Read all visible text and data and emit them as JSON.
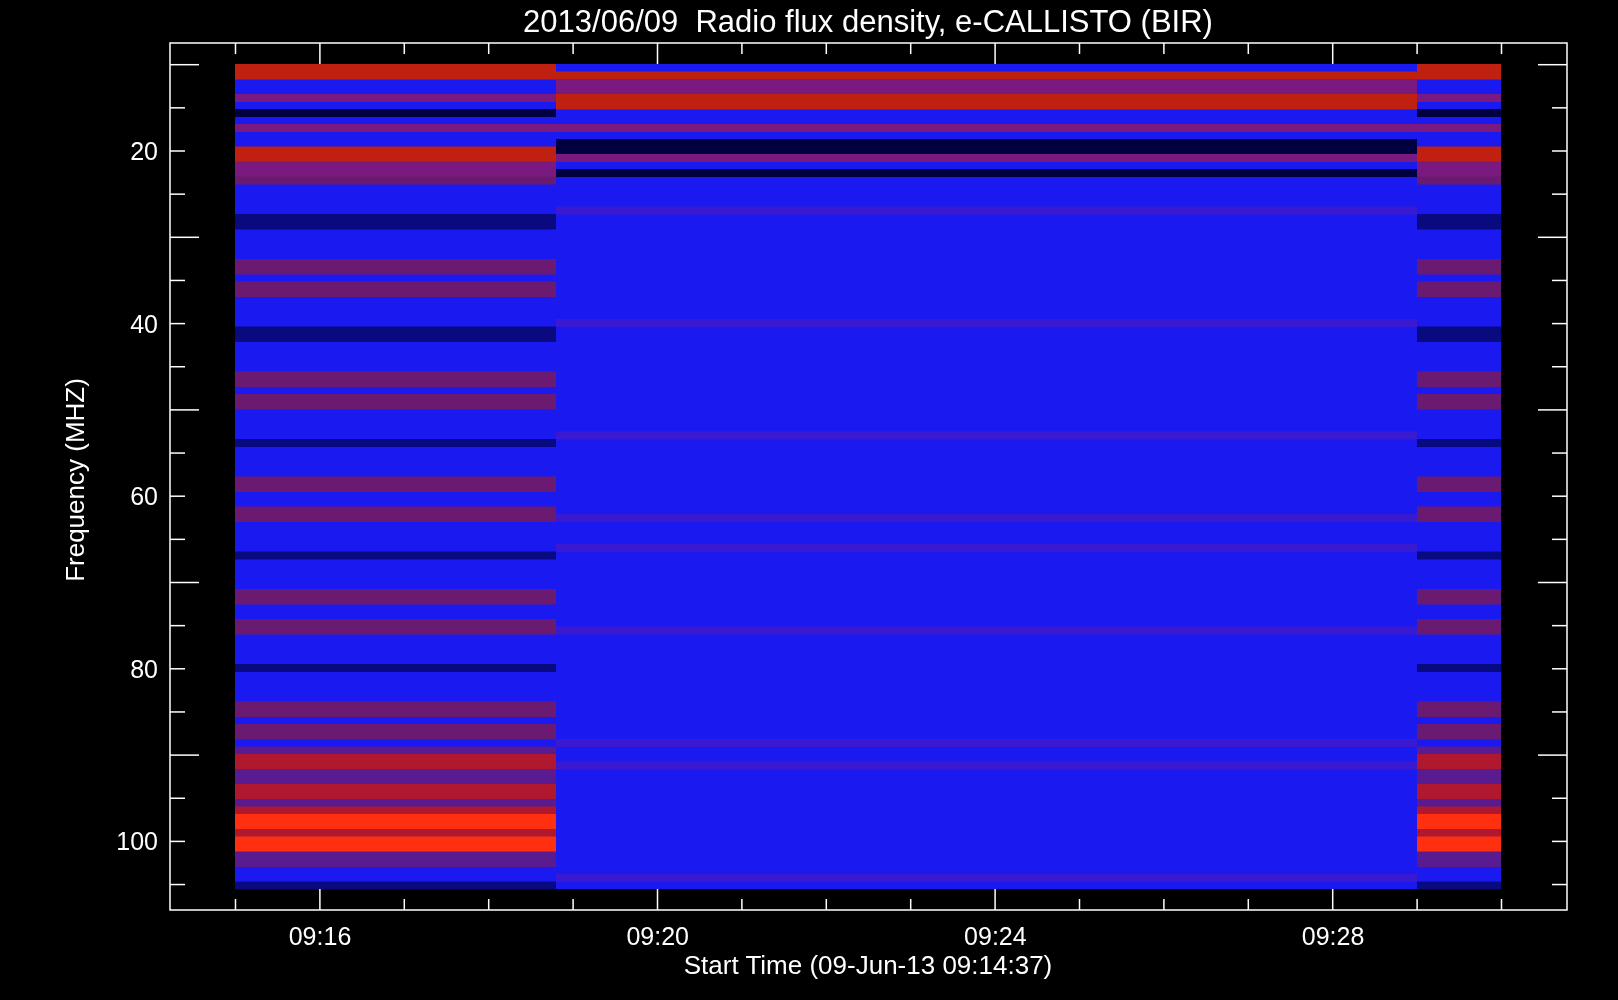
{
  "title": "2013/06/09  Radio flux density, e-CALLISTO (BIR)",
  "ylabel": "Frequency (MHZ)",
  "xlabel": "Start Time (09-Jun-13 09:14:37)",
  "yticks": [
    "20",
    "40",
    "60",
    "80",
    "100"
  ],
  "xticks": [
    "09:16",
    "09:20",
    "09:24",
    "09:28"
  ]
}
